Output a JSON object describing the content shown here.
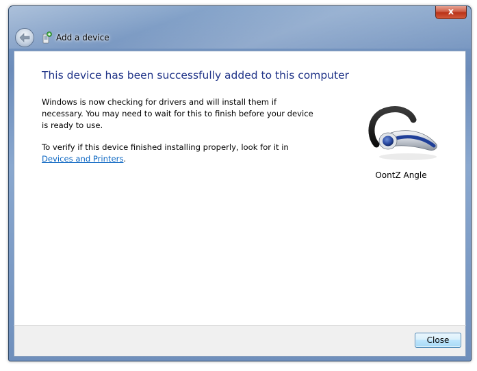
{
  "window": {
    "title": "Add a device",
    "close_glyph": "x"
  },
  "content": {
    "heading": "This device has been successfully added to this computer",
    "paragraph1": "Windows is now checking for drivers and will install them if necessary. You may need to wait for this to finish before your device is ready to use.",
    "paragraph2_prefix": "To verify if this device finished installing properly, look for it in",
    "paragraph2_link": "Devices and Printers",
    "paragraph2_suffix": ".",
    "device_name": "OontZ Angle"
  },
  "footer": {
    "close_label": "Close"
  },
  "icons": {
    "back": "back-arrow-icon",
    "title": "add-device-icon",
    "device": "bluetooth-headset-icon"
  },
  "colors": {
    "heading": "#1e3287",
    "link": "#0b66c2",
    "frame": "#6c8cba",
    "button_border": "#3c7fb1"
  }
}
